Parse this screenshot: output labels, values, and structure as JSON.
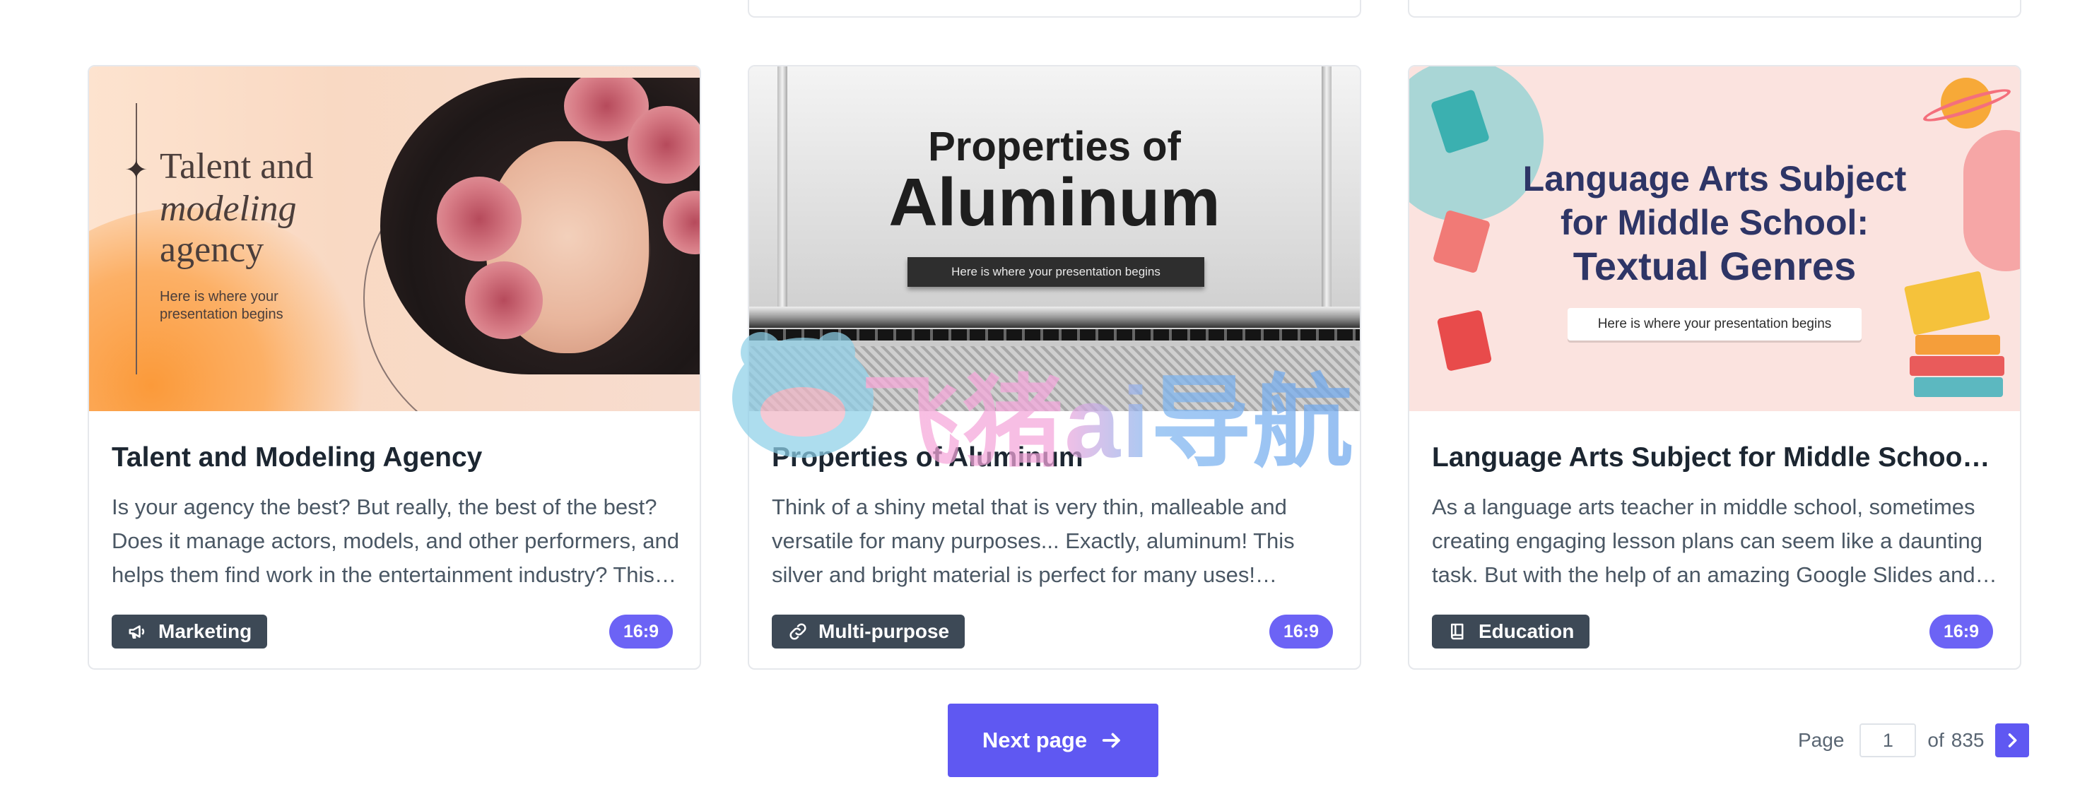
{
  "cards": [
    {
      "thumb": {
        "line1a": "Talent",
        "line1b": "and",
        "line2": "modeling",
        "line3": "agency",
        "tagline_l1": "Here is where your",
        "tagline_l2": "presentation begins"
      },
      "title": "Talent and Modeling Agency",
      "description": "Is your agency the best? But really, the best of the best? Does it manage actors, models, and other performers, and helps them find work in the entertainment industry? This template is perfect for your presentations.",
      "category": "Marketing",
      "category_icon": "megaphone-icon",
      "ratio": "16:9"
    },
    {
      "thumb": {
        "line1": "Properties of",
        "line2": "Aluminum",
        "tagline": "Here is where your presentation begins"
      },
      "title": "Properties of Aluminum",
      "description": "Think of a shiny metal that is very thin, malleable and versatile for many purposes... Exactly, aluminum! This silver and bright material is perfect for many uses! Speaking of its properties, this template is ready.",
      "category": "Multi-purpose",
      "category_icon": "link-icon",
      "ratio": "16:9"
    },
    {
      "thumb": {
        "line1": "Language Arts Subject",
        "line2": "for Middle School:",
        "line3": "Textual Genres",
        "tagline": "Here is where your presentation begins"
      },
      "title": "Language Arts Subject for Middle School: Textual Genres",
      "description": "As a language arts teacher in middle school, sometimes creating engaging lesson plans can seem like a daunting task. But with the help of an amazing Google Slides and PowerPoint template, it is easy.",
      "category": "Education",
      "category_icon": "book-icon",
      "ratio": "16:9"
    }
  ],
  "pagination": {
    "next_label": "Next page",
    "page_label": "Page",
    "current_page": "1",
    "of_label": "of",
    "total_pages": "835"
  },
  "watermark": {
    "text": "飞猪ai导航"
  },
  "colors": {
    "accent": "#5f58f2",
    "badge_dark": "#3d4956",
    "ratio_badge": "#6c63f5"
  }
}
